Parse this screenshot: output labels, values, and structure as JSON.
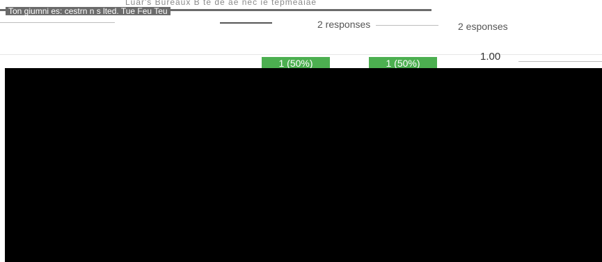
{
  "header": {
    "garbled_title": "Ton giumni es: cestrn n s lted. Tue Feu Teu",
    "faint_text": "Luar's Bureaux B te de ae nec ie tepmeaiae"
  },
  "chart": {
    "response_count_a": "2 responses",
    "response_count_b": "2 esponses",
    "axis_value": "1.00",
    "bar_labels": [
      "1 (50%)",
      "1 (50%)"
    ],
    "bar_color": "#4caf50"
  },
  "panel": {
    "color": "#000000"
  }
}
